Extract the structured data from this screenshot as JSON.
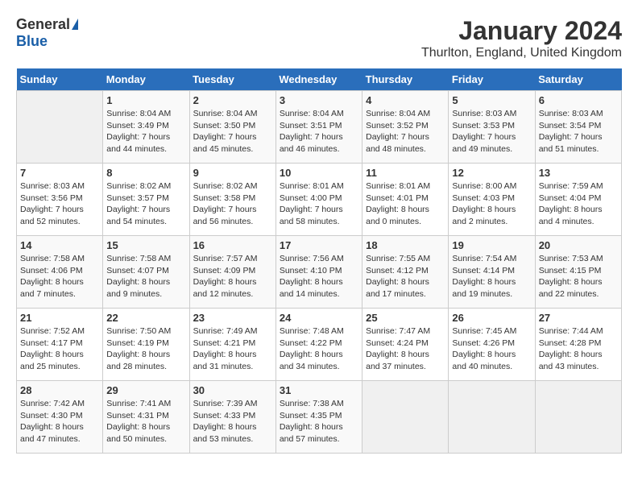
{
  "header": {
    "logo_general": "General",
    "logo_blue": "Blue",
    "title": "January 2024",
    "subtitle": "Thurlton, England, United Kingdom"
  },
  "days_of_week": [
    "Sunday",
    "Monday",
    "Tuesday",
    "Wednesday",
    "Thursday",
    "Friday",
    "Saturday"
  ],
  "weeks": [
    [
      {
        "day": "",
        "info": ""
      },
      {
        "day": "1",
        "info": "Sunrise: 8:04 AM\nSunset: 3:49 PM\nDaylight: 7 hours\nand 44 minutes."
      },
      {
        "day": "2",
        "info": "Sunrise: 8:04 AM\nSunset: 3:50 PM\nDaylight: 7 hours\nand 45 minutes."
      },
      {
        "day": "3",
        "info": "Sunrise: 8:04 AM\nSunset: 3:51 PM\nDaylight: 7 hours\nand 46 minutes."
      },
      {
        "day": "4",
        "info": "Sunrise: 8:04 AM\nSunset: 3:52 PM\nDaylight: 7 hours\nand 48 minutes."
      },
      {
        "day": "5",
        "info": "Sunrise: 8:03 AM\nSunset: 3:53 PM\nDaylight: 7 hours\nand 49 minutes."
      },
      {
        "day": "6",
        "info": "Sunrise: 8:03 AM\nSunset: 3:54 PM\nDaylight: 7 hours\nand 51 minutes."
      }
    ],
    [
      {
        "day": "7",
        "info": "Sunrise: 8:03 AM\nSunset: 3:56 PM\nDaylight: 7 hours\nand 52 minutes."
      },
      {
        "day": "8",
        "info": "Sunrise: 8:02 AM\nSunset: 3:57 PM\nDaylight: 7 hours\nand 54 minutes."
      },
      {
        "day": "9",
        "info": "Sunrise: 8:02 AM\nSunset: 3:58 PM\nDaylight: 7 hours\nand 56 minutes."
      },
      {
        "day": "10",
        "info": "Sunrise: 8:01 AM\nSunset: 4:00 PM\nDaylight: 7 hours\nand 58 minutes."
      },
      {
        "day": "11",
        "info": "Sunrise: 8:01 AM\nSunset: 4:01 PM\nDaylight: 8 hours\nand 0 minutes."
      },
      {
        "day": "12",
        "info": "Sunrise: 8:00 AM\nSunset: 4:03 PM\nDaylight: 8 hours\nand 2 minutes."
      },
      {
        "day": "13",
        "info": "Sunrise: 7:59 AM\nSunset: 4:04 PM\nDaylight: 8 hours\nand 4 minutes."
      }
    ],
    [
      {
        "day": "14",
        "info": "Sunrise: 7:58 AM\nSunset: 4:06 PM\nDaylight: 8 hours\nand 7 minutes."
      },
      {
        "day": "15",
        "info": "Sunrise: 7:58 AM\nSunset: 4:07 PM\nDaylight: 8 hours\nand 9 minutes."
      },
      {
        "day": "16",
        "info": "Sunrise: 7:57 AM\nSunset: 4:09 PM\nDaylight: 8 hours\nand 12 minutes."
      },
      {
        "day": "17",
        "info": "Sunrise: 7:56 AM\nSunset: 4:10 PM\nDaylight: 8 hours\nand 14 minutes."
      },
      {
        "day": "18",
        "info": "Sunrise: 7:55 AM\nSunset: 4:12 PM\nDaylight: 8 hours\nand 17 minutes."
      },
      {
        "day": "19",
        "info": "Sunrise: 7:54 AM\nSunset: 4:14 PM\nDaylight: 8 hours\nand 19 minutes."
      },
      {
        "day": "20",
        "info": "Sunrise: 7:53 AM\nSunset: 4:15 PM\nDaylight: 8 hours\nand 22 minutes."
      }
    ],
    [
      {
        "day": "21",
        "info": "Sunrise: 7:52 AM\nSunset: 4:17 PM\nDaylight: 8 hours\nand 25 minutes."
      },
      {
        "day": "22",
        "info": "Sunrise: 7:50 AM\nSunset: 4:19 PM\nDaylight: 8 hours\nand 28 minutes."
      },
      {
        "day": "23",
        "info": "Sunrise: 7:49 AM\nSunset: 4:21 PM\nDaylight: 8 hours\nand 31 minutes."
      },
      {
        "day": "24",
        "info": "Sunrise: 7:48 AM\nSunset: 4:22 PM\nDaylight: 8 hours\nand 34 minutes."
      },
      {
        "day": "25",
        "info": "Sunrise: 7:47 AM\nSunset: 4:24 PM\nDaylight: 8 hours\nand 37 minutes."
      },
      {
        "day": "26",
        "info": "Sunrise: 7:45 AM\nSunset: 4:26 PM\nDaylight: 8 hours\nand 40 minutes."
      },
      {
        "day": "27",
        "info": "Sunrise: 7:44 AM\nSunset: 4:28 PM\nDaylight: 8 hours\nand 43 minutes."
      }
    ],
    [
      {
        "day": "28",
        "info": "Sunrise: 7:42 AM\nSunset: 4:30 PM\nDaylight: 8 hours\nand 47 minutes."
      },
      {
        "day": "29",
        "info": "Sunrise: 7:41 AM\nSunset: 4:31 PM\nDaylight: 8 hours\nand 50 minutes."
      },
      {
        "day": "30",
        "info": "Sunrise: 7:39 AM\nSunset: 4:33 PM\nDaylight: 8 hours\nand 53 minutes."
      },
      {
        "day": "31",
        "info": "Sunrise: 7:38 AM\nSunset: 4:35 PM\nDaylight: 8 hours\nand 57 minutes."
      },
      {
        "day": "",
        "info": ""
      },
      {
        "day": "",
        "info": ""
      },
      {
        "day": "",
        "info": ""
      }
    ]
  ]
}
